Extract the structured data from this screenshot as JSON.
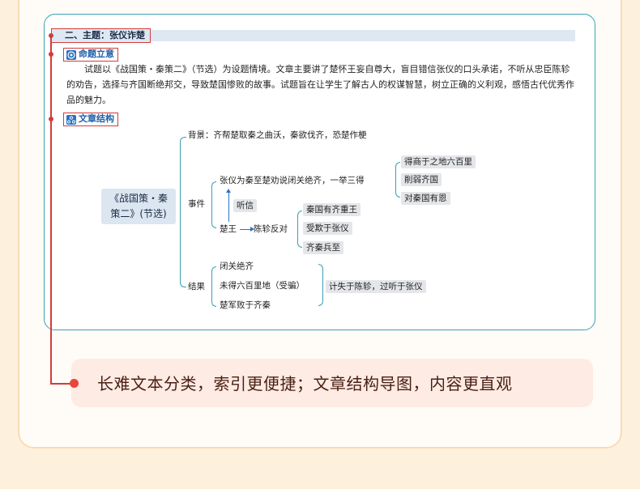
{
  "section": {
    "title": "二、主题：张仪诈楚"
  },
  "intent": {
    "label": "命题立意",
    "text": "试题以《战国策・秦策二》（节选）为设题情境。文章主要讲了楚怀王妄自尊大，盲目错信张仪的口头承诺，不听从忠臣陈轸的劝告，选择与齐国断绝邦交，导致楚国惨败的故事。试题旨在让学生了解古人的权谋智慧，树立正确的义利观，感悟古代优秀作品的魅力。"
  },
  "structure": {
    "label": "文章结构",
    "root_line1": "《战国策・秦",
    "root_line2": "策二》(节选)",
    "background": "背景：齐帮楚取秦之曲沃，秦欲伐齐，恐楚作梗",
    "events_label": "事件",
    "zhangyi": "张仪为秦至楚劝说闭关绝齐，一举三得",
    "gains": [
      "得商于之地六百里",
      "削弱齐国",
      "对秦国有恩"
    ],
    "listen": "听信",
    "chuwang": "楚王",
    "chenzhen": "陈轸反对",
    "reasons": [
      "秦国有齐重王",
      "受欺于张仪",
      "齐秦兵至"
    ],
    "result_label": "结果",
    "results": [
      "闭关绝齐",
      "未得六百里地（受骗）",
      "楚军败于齐秦"
    ],
    "conclusion": "计失于陈轸，过听于张仪"
  },
  "summary": "长难文本分类，索引更便捷；文章结构导图，内容更直观",
  "colors": {
    "accent_red": "#d23c3c",
    "accent_blue": "#2a73c4",
    "teal": "#3aa0b8"
  }
}
